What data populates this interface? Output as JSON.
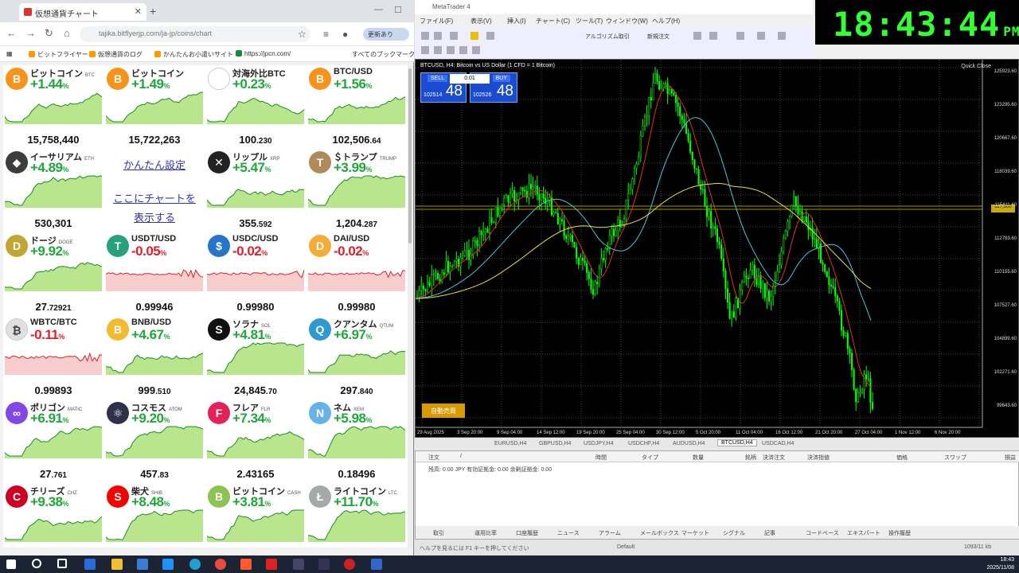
{
  "browser": {
    "tab_title": "仮想通貨チャート",
    "url": "tajika.bitflyerjp.com/ja-jp/coins/chart",
    "profile_label": "更新あり",
    "bookmarks": [
      "ビットフライヤー",
      "仮想通貨のログ",
      "かんたんお小遣いサイト",
      "https://jpcn.com/",
      "すべてのブックマーク"
    ]
  },
  "tiles": [
    {
      "name": "ビットコイン",
      "sym": "BTC",
      "icon": "B",
      "icon_color": "#f7931a",
      "change": "+1.44",
      "dir": "up",
      "price_main": "15,758,440",
      "price_dec": ""
    },
    {
      "name": "ビットコイン",
      "sym": "",
      "icon": "B",
      "icon_color": "#f7931a",
      "change": "+1.49",
      "dir": "up",
      "price_main": "15,722,263",
      "price_dec": ""
    },
    {
      "name": "対海外比BTC",
      "sym": "",
      "icon": "",
      "icon_color": "#ffffff",
      "change": "+0.23",
      "dir": "up",
      "price_main": "100",
      "price_dec": ".230"
    },
    {
      "name": "BTC/USD",
      "sym": "",
      "icon": "B",
      "icon_color": "#f7931a",
      "change": "+1.56",
      "dir": "up",
      "price_main": "102,506",
      "price_dec": ".64"
    },
    {
      "name": "イーサリアム",
      "sym": "ETH",
      "icon": "◆",
      "icon_color": "#3c3c3d",
      "change": "+4.89",
      "dir": "up",
      "price_main": "530,301",
      "price_dec": ""
    },
    {
      "name": "",
      "sym": "",
      "icon": "",
      "icon_color": "#ffffff",
      "change": "",
      "dir": "up",
      "price_main": "",
      "price_dec": "",
      "promo": true
    },
    {
      "name": "リップル",
      "sym": "XRP",
      "icon": "✕",
      "icon_color": "#222222",
      "change": "+5.47",
      "dir": "up",
      "price_main": "355",
      "price_dec": ".592"
    },
    {
      "name": "＄トランプ",
      "sym": "TRUMP",
      "icon": "T",
      "icon_color": "#b08a5a",
      "change": "+3.99",
      "dir": "up",
      "price_main": "1,204",
      "price_dec": ".287"
    },
    {
      "name": "ドージ",
      "sym": "DOGE",
      "icon": "D",
      "icon_color": "#c2a633",
      "change": "+9.92",
      "dir": "up",
      "price_main": "27",
      "price_dec": ".72921"
    },
    {
      "name": "USDT/USD",
      "sym": "",
      "icon": "T",
      "icon_color": "#26a17b",
      "change": "-0.05",
      "dir": "dn",
      "price_main": "0.99946",
      "price_dec": ""
    },
    {
      "name": "USDC/USD",
      "sym": "",
      "icon": "$",
      "icon_color": "#2775ca",
      "change": "-0.02",
      "dir": "dn",
      "price_main": "0.99980",
      "price_dec": ""
    },
    {
      "name": "DAI/USD",
      "sym": "",
      "icon": "D",
      "icon_color": "#f5ac37",
      "change": "-0.02",
      "dir": "dn",
      "price_main": "0.99980",
      "price_dec": ""
    },
    {
      "name": "WBTC/BTC",
      "sym": "",
      "icon": "₿",
      "icon_color": "#e0e0e0",
      "change": "-0.11",
      "dir": "dn",
      "price_main": "0.99893",
      "price_dec": ""
    },
    {
      "name": "BNB/USD",
      "sym": "",
      "icon": "B",
      "icon_color": "#f3ba2f",
      "change": "+4.67",
      "dir": "up",
      "price_main": "999",
      "price_dec": ".510"
    },
    {
      "name": "ソラナ",
      "sym": "SOL",
      "icon": "S",
      "icon_color": "#111111",
      "change": "+4.81",
      "dir": "up",
      "price_main": "24,845",
      "price_dec": ".70"
    },
    {
      "name": "クアンタム",
      "sym": "QTUM",
      "icon": "Q",
      "icon_color": "#2e9ad0",
      "change": "+6.97",
      "dir": "up",
      "price_main": "297",
      "price_dec": ".840"
    },
    {
      "name": "ポリゴン",
      "sym": "MATIC",
      "icon": "∞",
      "icon_color": "#8247e5",
      "change": "+6.91",
      "dir": "up",
      "price_main": "27",
      "price_dec": ".761"
    },
    {
      "name": "コスモス",
      "sym": "ATOM",
      "icon": "⚛",
      "icon_color": "#2e3148",
      "change": "+9.20",
      "dir": "up",
      "price_main": "457",
      "price_dec": ".83"
    },
    {
      "name": "フレア",
      "sym": "FLR",
      "icon": "F",
      "icon_color": "#e62058",
      "change": "+7.34",
      "dir": "up",
      "price_main": "2.43165",
      "price_dec": ""
    },
    {
      "name": "ネム",
      "sym": "XEM",
      "icon": "N",
      "icon_color": "#67b2e8",
      "change": "+5.98",
      "dir": "up",
      "price_main": "0.18496",
      "price_dec": ""
    },
    {
      "name": "チリーズ",
      "sym": "CHZ",
      "icon": "C",
      "icon_color": "#cd0124",
      "change": "+9.38",
      "dir": "up",
      "price_main": "",
      "price_dec": ""
    },
    {
      "name": "柴犬",
      "sym": "SHIB",
      "icon": "S",
      "icon_color": "#f00500",
      "change": "+8.48",
      "dir": "up",
      "price_main": "",
      "price_dec": ""
    },
    {
      "name": "ビットコイン",
      "sym": "CASH",
      "icon": "B",
      "icon_color": "#8dc351",
      "change": "+3.81",
      "dir": "up",
      "price_main": "",
      "price_dec": ""
    },
    {
      "name": "ライトコイン",
      "sym": "LTC",
      "icon": "Ł",
      "icon_color": "#a6a9aa",
      "change": "+11.70",
      "dir": "up",
      "price_main": "",
      "price_dec": ""
    }
  ],
  "promo": {
    "line1": "かんたん設定",
    "line2": "ここにチャートを",
    "line3": "表示する"
  },
  "pct_sign": "%",
  "mt4": {
    "window_title": "MetaTrader 4",
    "menu": [
      "ファイル(F)",
      "表示(V)",
      "挿入(I)",
      "チャート(C)",
      "ツール(T)",
      "ウィンドウ(W)",
      "ヘルプ(H)"
    ],
    "toolbar_autotrade": "アルゴリズム取引",
    "toolbar_neworder": "新規注文",
    "chart_title": "BTCUSD, H4: Bitcoin vs US Dollar (1 CFD = 1 Bitcoin)",
    "quick_close": "Quick Close",
    "sell_label": "SELL",
    "buy_label": "BUY",
    "lot": "0.01",
    "sell_small": "102514",
    "sell_big": "48",
    "buy_small": "102526",
    "buy_big": "48",
    "auto_button": "自動売買",
    "current_price_label": "117,500",
    "y_labels": [
      "125923.60",
      "123295.60",
      "120667.60",
      "118039.60",
      "115411.60",
      "112783.60",
      "110155.60",
      "107527.60",
      "104899.60",
      "102271.60",
      "99643.60"
    ],
    "x_labels": [
      "29 Aug 2025",
      "3 Sep 20:00",
      "9 Sep 04:00",
      "14 Sep 12:00",
      "19 Sep 20:00",
      "25 Sep 04:00",
      "30 Sep 12:00",
      "5 Oct 20:00",
      "11 Oct 04:00",
      "16 Oct 12:00",
      "21 Oct 20:00",
      "27 Oct 04:00",
      "1 Nov 12:00",
      "6 Nov 20:00"
    ],
    "chart_tabs": [
      "EURUSD,H4",
      "GBPUSD,H4",
      "USDJPY,H4",
      "USDCHF,H4",
      "AUDUSD,H4",
      "BTCUSD,H4",
      "USDCAD,H4"
    ],
    "active_tab": "BTCUSD,H4",
    "terminal_headers": [
      "注文",
      "/",
      "時間",
      "タイプ",
      "数量",
      "銘柄",
      "決済注文",
      "決済指値",
      "価格",
      "スワップ",
      "損益"
    ],
    "terminal_row": "残高: 0.00 JPY  有効証拠金: 0.00 余剰証拠金: 0.00",
    "terminal_tabs": [
      "取引",
      "運用比率",
      "口座履歴",
      "ニュース",
      "アラーム",
      "メールボックス",
      "マーケット",
      "シグナル",
      "記事",
      "コードベース",
      "エキスパート",
      "操作履歴"
    ],
    "status_left": "ヘルプを見るには F1 キーを押してください",
    "status_mid": "Default",
    "status_right": "1093/11 kb"
  },
  "clock": {
    "time": "18:43:44",
    "ampm": "PM"
  },
  "taskbar": {
    "time": "18:43",
    "date": "2025/11/08"
  }
}
